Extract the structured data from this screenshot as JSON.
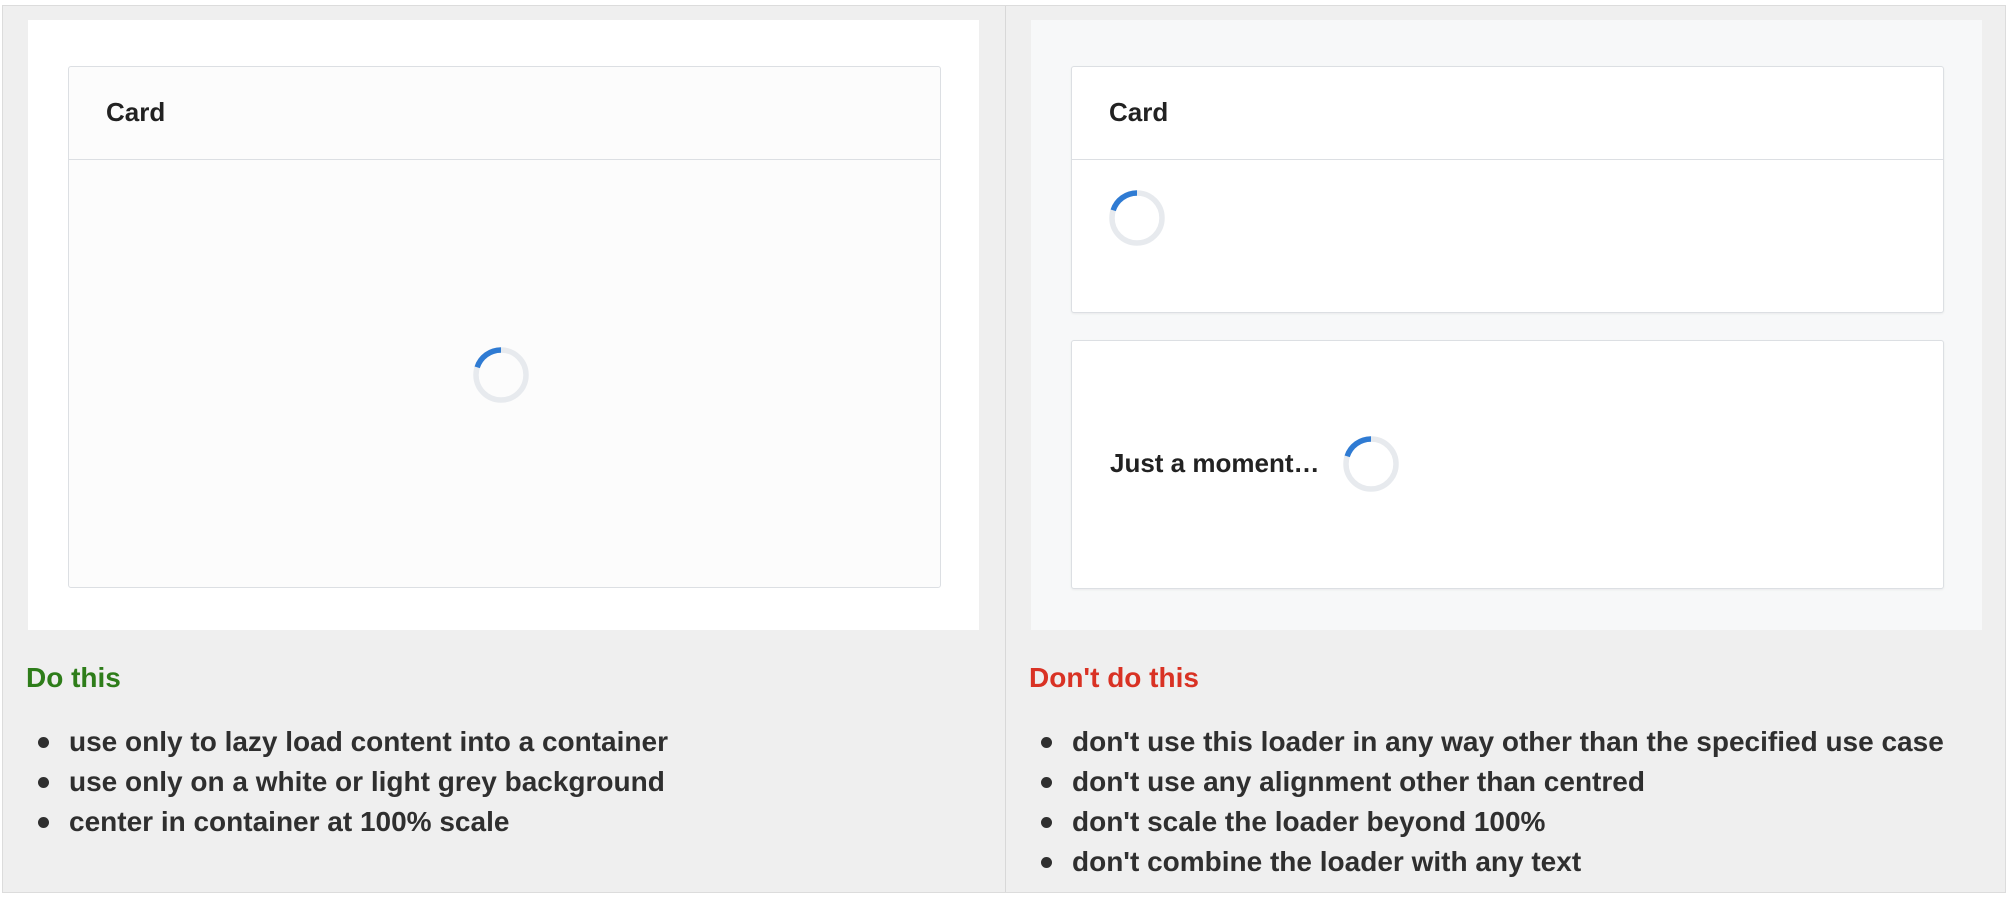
{
  "do_panel": {
    "card_title": "Card",
    "heading": "Do this",
    "rules": [
      "use only to lazy load content into a container",
      "use only on a white or light grey background",
      "center in container at 100% scale"
    ]
  },
  "dont_panel": {
    "card_title": "Card",
    "loading_text": "Just a moment…",
    "heading": "Don't do this",
    "rules": [
      "don't use this loader in any way other than the specified use case",
      "don't use any alignment other than centred",
      "don't scale the loader beyond 100%",
      "don't combine the loader with any text"
    ]
  },
  "colors": {
    "do_heading": "#2e7d1a",
    "dont_heading": "#d93224",
    "spinner_track": "#e7eaee",
    "spinner_arc": "#2f7bd3"
  },
  "icons": {
    "spinner": "loading-spinner-icon",
    "bullet": "bullet-dot-icon"
  }
}
